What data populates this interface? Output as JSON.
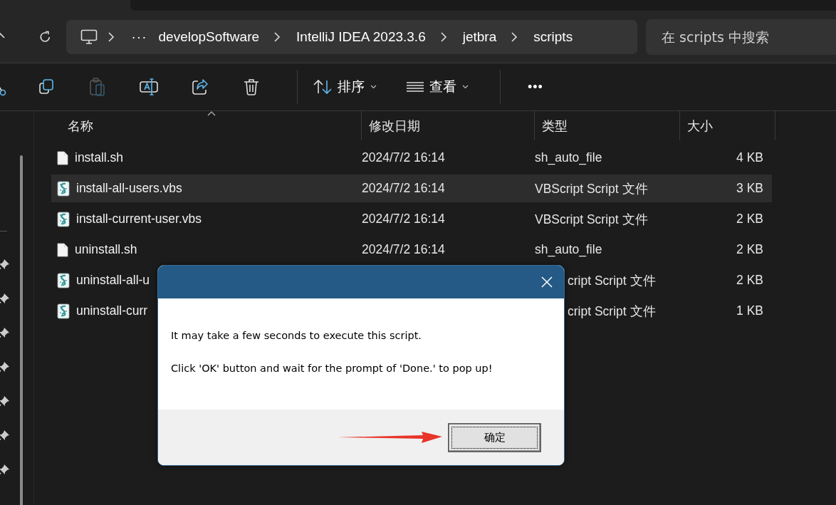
{
  "breadcrumb": {
    "overflow": "···",
    "items": [
      "developSoftware",
      "IntelliJ IDEA 2023.3.6",
      "jetbra",
      "scripts"
    ]
  },
  "search": {
    "placeholder": "在 scripts 中搜索"
  },
  "toolbar": {
    "actions": [
      {
        "kind": "copy",
        "disabled": false
      },
      {
        "kind": "paste",
        "disabled": true
      },
      {
        "kind": "rename",
        "disabled": false
      },
      {
        "kind": "share",
        "disabled": false
      },
      {
        "kind": "delete",
        "disabled": false
      }
    ],
    "sort": "排序",
    "view": "查看",
    "more": "•••"
  },
  "table": {
    "columns": [
      "名称",
      "修改日期",
      "类型",
      "大小"
    ],
    "rows": [
      {
        "kind": "sh",
        "name": "install.sh",
        "date": "2024/7/2 16:14",
        "type": "sh_auto_file",
        "size": "4 KB",
        "selected": false,
        "covered": false
      },
      {
        "kind": "vbs",
        "name": "install-all-users.vbs",
        "date": "2024/7/2 16:14",
        "type": "VBScript Script 文件",
        "size": "3 KB",
        "selected": true,
        "covered": false
      },
      {
        "kind": "vbs",
        "name": "install-current-user.vbs",
        "date": "2024/7/2 16:14",
        "type": "VBScript Script 文件",
        "size": "2 KB",
        "selected": false,
        "covered": false
      },
      {
        "kind": "sh",
        "name": "uninstall.sh",
        "date": "2024/7/2 16:14",
        "type": "sh_auto_file",
        "size": "2 KB",
        "selected": false,
        "covered": false
      },
      {
        "kind": "vbs",
        "name": "uninstall-all-u",
        "type": "cript Script 文件",
        "size": "2 KB",
        "selected": false,
        "covered": true
      },
      {
        "kind": "vbs",
        "name": "uninstall-curr",
        "type": "cript Script 文件",
        "size": "1 KB",
        "selected": false,
        "covered": true
      }
    ]
  },
  "dialog": {
    "lines": [
      "It may take a few seconds to execute this script.",
      "Click 'OK' button and wait for the prompt of 'Done.' to pop up!"
    ],
    "button": "确定"
  }
}
